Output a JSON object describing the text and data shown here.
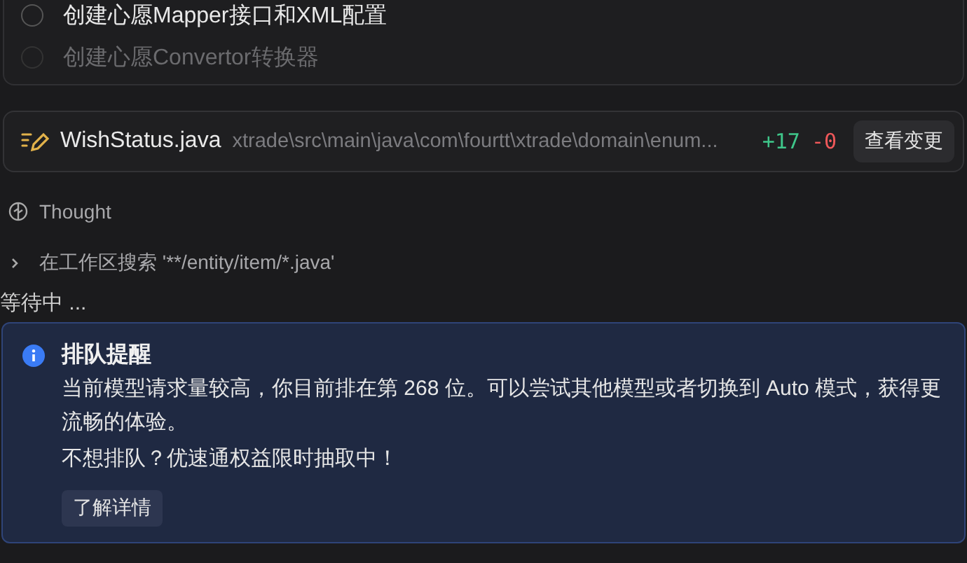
{
  "todos": [
    {
      "label": "创建心愿Mapper接口和XML配置",
      "disabled": false
    },
    {
      "label": "创建心愿Convertor转换器",
      "disabled": true
    }
  ],
  "file_change": {
    "name": "WishStatus.java",
    "path": "xtrade\\src\\main\\java\\com\\fourtt\\xtrade\\domain\\enum...",
    "added": "+17",
    "removed": "-0",
    "button": "查看变更"
  },
  "thought": {
    "label": "Thought"
  },
  "search_step": {
    "label": "在工作区搜索 '**/entity/item/*.java'",
    "expanded": false
  },
  "waiting": "等待中 ...",
  "notice": {
    "title": "排队提醒",
    "lines": [
      "当前模型请求量较高，你目前排在第 268 位。可以尝试其他模型或者切换到 Auto 模式，获得更流畅的体验。",
      "不想排队？优速通权益限时抽取中！"
    ],
    "button": "了解详情"
  }
}
